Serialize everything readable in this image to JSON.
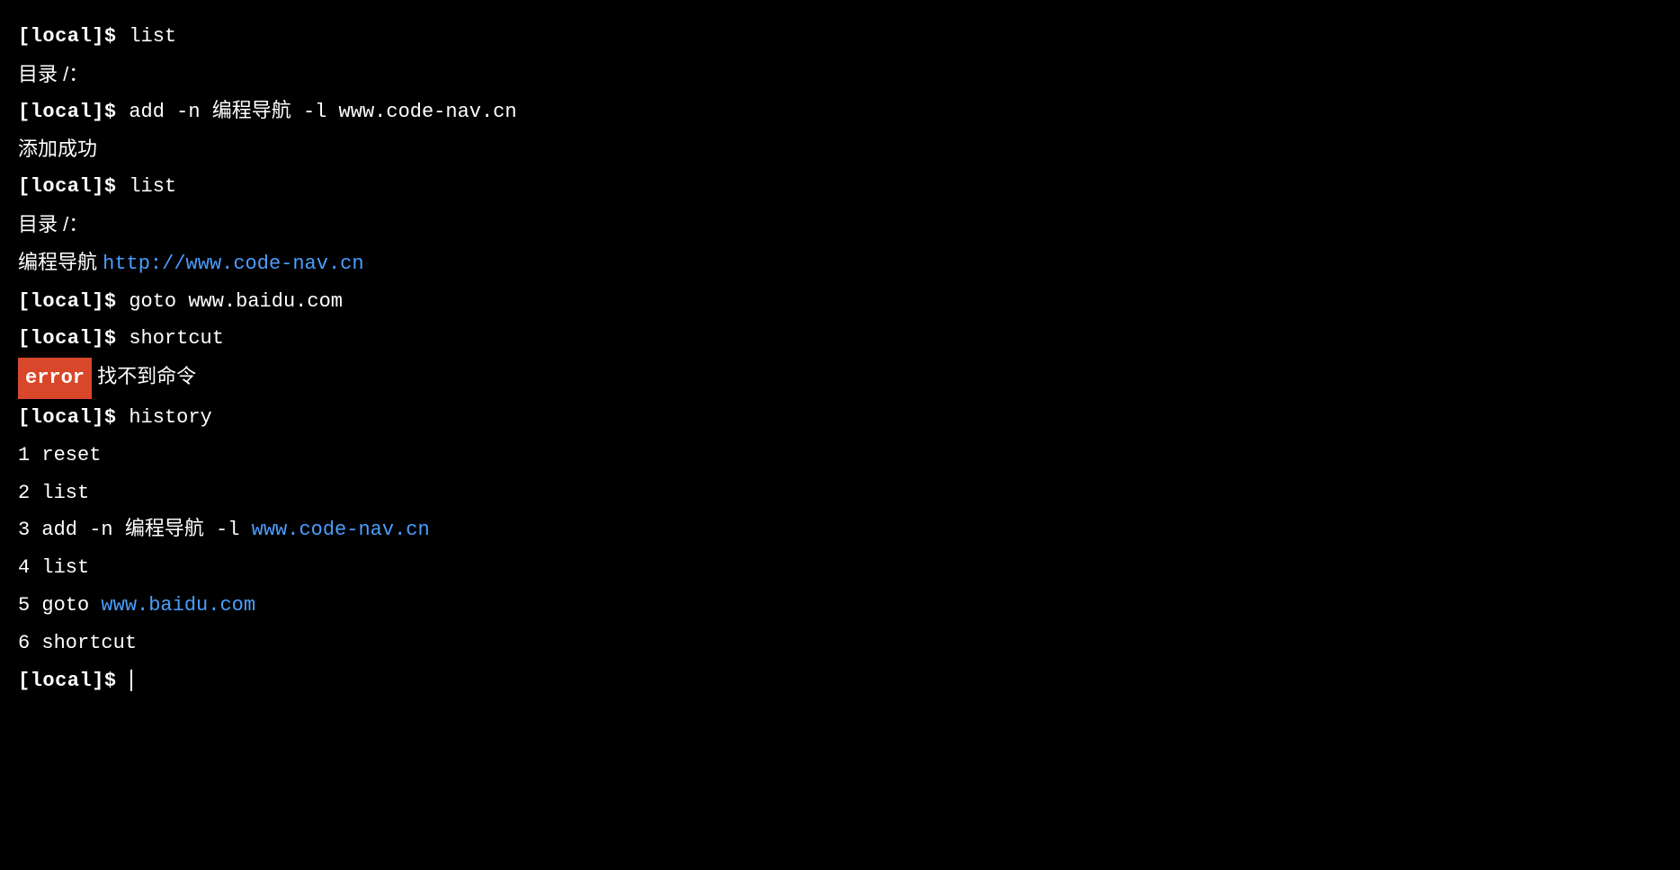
{
  "prompt": "[local]$ ",
  "lines": {
    "cmd1": "list",
    "out1": "目录 /：",
    "cmd2": "add -n 编程导航 -l www.code-nav.cn",
    "out2": "添加成功",
    "cmd3": "list",
    "out3": "目录 /：",
    "out4_prefix": "编程导航 ",
    "out4_link": "http://www.code-nav.cn",
    "cmd4": "goto www.baidu.com",
    "cmd5": "shortcut",
    "error_label": "error",
    "error_msg": " 找不到命令",
    "cmd6": "history",
    "hist1": "1 reset",
    "hist2": "2 list",
    "hist3_prefix": "3 add -n 编程导航 -l ",
    "hist3_link": "www.code-nav.cn",
    "hist4": "4 list",
    "hist5_prefix": "5 goto ",
    "hist5_link": "www.baidu.com",
    "hist6": "6 shortcut"
  }
}
